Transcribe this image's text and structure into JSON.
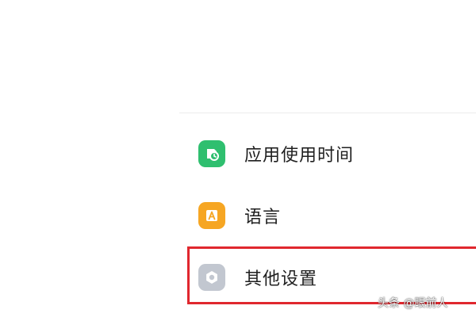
{
  "settings": {
    "items": [
      {
        "label": "应用使用时间",
        "icon": "app-usage-time-icon",
        "icon_color": "#2fbf6f"
      },
      {
        "label": "语言",
        "icon": "language-icon",
        "icon_color": "#f6a623"
      },
      {
        "label": "其他设置",
        "icon": "other-settings-icon",
        "icon_color": "#c2c7d0"
      }
    ]
  },
  "highlight": {
    "color": "#e0272e"
  },
  "watermark": {
    "text": "头条 @眼前人"
  }
}
